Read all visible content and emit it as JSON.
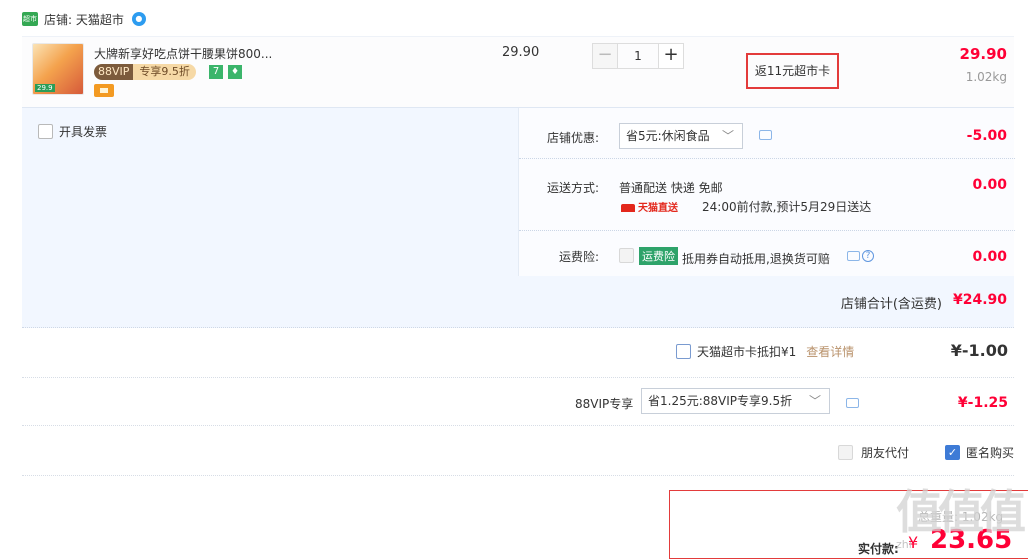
{
  "shop": {
    "logo_text": "超市",
    "name": "店铺: 天猫超市"
  },
  "item": {
    "thumb_label": "29.9",
    "title": "大牌新享好吃点饼干腰果饼800...",
    "vip_tag": "88VIP",
    "vip_discount": "专享9.5折",
    "badge_7": "7",
    "unit_price": "29.90",
    "quantity": "1",
    "minus": "−",
    "plus": "+",
    "promo": "返11元超市卡",
    "subtotal": "29.90",
    "weight": "1.02kg"
  },
  "order_panel": {
    "invoice_label": "开具发票",
    "shop_discount_label": "店铺优惠:",
    "shop_discount_option": "省5元:休闲食品",
    "shop_discount_value": "-5.00",
    "shipping_label": "运送方式:",
    "shipping_method": "普通配送 快递 免邮",
    "tmall_direct": "天猫直送",
    "delivery_note": "24:00前付款,预计5月29日送达",
    "shipping_value": "0.00",
    "insurance_label": "运费险:",
    "insurance_tag": "运费险",
    "insurance_note": "抵用券自动抵用,退换货可赔",
    "insurance_value": "0.00",
    "shop_total_label": "店铺合计(含运费)",
    "shop_total_value": "¥24.90"
  },
  "market_card": {
    "label": "天猫超市卡抵扣¥1",
    "link": "查看详情",
    "value": "¥-1.00"
  },
  "vip": {
    "label": "88VIP专享",
    "option": "省1.25元:88VIP专享9.5折",
    "value": "¥-1.25"
  },
  "options": {
    "friend_pay": "朋友代付",
    "anonymous": "匿名购买"
  },
  "payment": {
    "weight_summary": "总重量: 1.02kg",
    "label": "实付款:",
    "currency": "¥",
    "amount": "23.65"
  },
  "watermark": {
    "text": "值值值",
    "sub": "zhi"
  },
  "colors": {
    "accent_red": "#ff0036",
    "panel_bg": "#f2f7ff",
    "tmall_green": "#34a853",
    "highlight_border": "#e33b3b"
  }
}
